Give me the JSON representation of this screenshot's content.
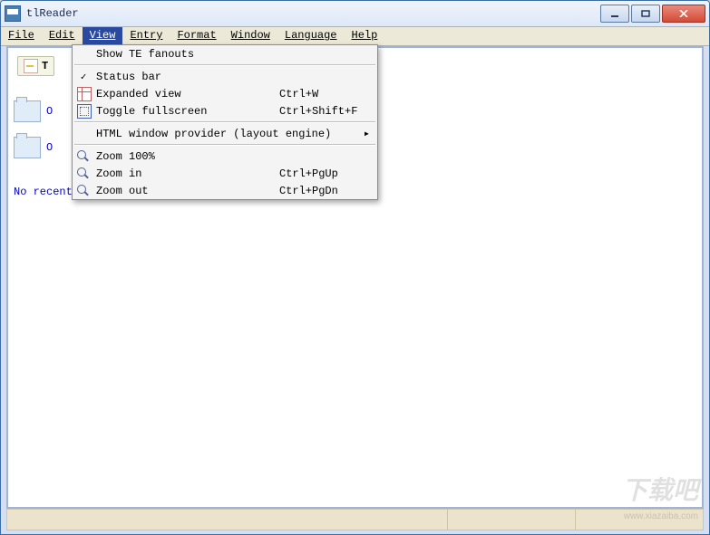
{
  "titlebar": {
    "title": "tlReader"
  },
  "menubar": {
    "file": "File",
    "edit": "Edit",
    "view": "View",
    "entry": "Entry",
    "format": "Format",
    "window": "Window",
    "language": "Language",
    "help": "Help"
  },
  "view_menu": {
    "show_fanouts": "Show TE fanouts",
    "status_bar": "Status bar",
    "expanded_view": "Expanded view",
    "expanded_view_sc": "Ctrl+W",
    "toggle_fullscreen": "Toggle fullscreen",
    "toggle_fullscreen_sc": "Ctrl+Shift+F",
    "html_provider": "HTML window provider (layout engine)",
    "zoom_100": "Zoom 100%",
    "zoom_in": "Zoom in",
    "zoom_in_sc": "Ctrl+PgUp",
    "zoom_out": "Zoom out",
    "zoom_out_sc": "Ctrl+PgDn"
  },
  "sidebar": {
    "tab_label": "T",
    "link1": "O",
    "link2": "O",
    "no_recent": "No recent documents."
  },
  "watermark": "下载吧"
}
